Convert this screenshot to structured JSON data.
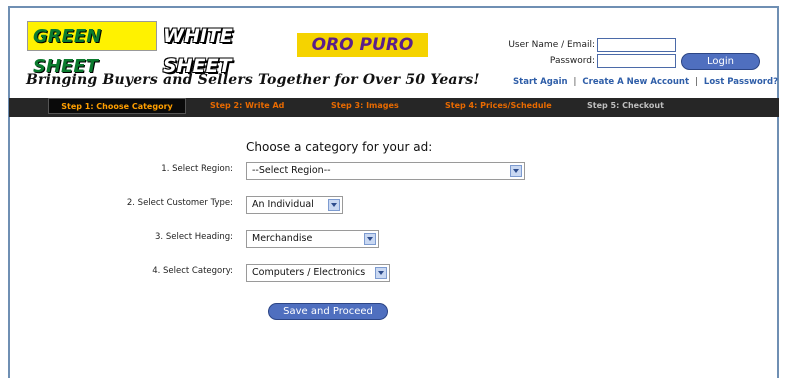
{
  "branding": {
    "logo_green": "GREEN SHEET",
    "logo_white": "WHITE SHEET",
    "logo_oro": "ORO PURO",
    "tagline": "Bringing Buyers and Sellers Together for Over 50 Years!"
  },
  "login": {
    "username_label": "User Name / Email:",
    "username_value": "",
    "password_label": "Password:",
    "password_value": "",
    "login_button": "Login",
    "links": [
      "Start Again",
      "Create A New Account",
      "Lost Password?"
    ]
  },
  "steps": [
    {
      "label": "Step 1: Choose Category",
      "active": true
    },
    {
      "label": "Step 2: Write Ad",
      "active": false
    },
    {
      "label": "Step 3: Images",
      "active": false
    },
    {
      "label": "Step 4: Prices/Schedule",
      "active": false
    },
    {
      "label": "Step 5: Checkout",
      "active": false
    }
  ],
  "form": {
    "heading": "Choose a category for your ad:",
    "fields": [
      {
        "label": "1. Select Region:",
        "value": "--Select Region--"
      },
      {
        "label": "2. Select Customer Type:",
        "value": "An Individual"
      },
      {
        "label": "3. Select Heading:",
        "value": "Merchandise"
      },
      {
        "label": "4. Select Category:",
        "value": "Computers / Electronics"
      }
    ],
    "submit": "Save and Proceed"
  },
  "colors": {
    "accent_button": "#4f6fbf",
    "link_blue": "#2f5ea8",
    "step_active": "#ff9f00",
    "step_inactive": "#e86a00",
    "steps_bar": "#262626"
  }
}
